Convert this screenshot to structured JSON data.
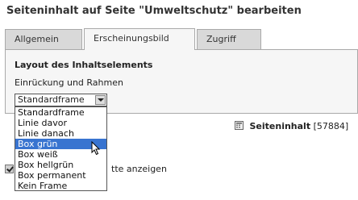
{
  "page": {
    "title": "Seiteninhalt auf Seite \"Umweltschutz\" bearbeiten"
  },
  "tabs": [
    {
      "label": "Allgemein"
    },
    {
      "label": "Erscheinungsbild",
      "active": true
    },
    {
      "label": "Zugriff"
    }
  ],
  "panel": {
    "section_heading": "Layout des Inhaltselements",
    "field_label": "Einrückung und Rahmen",
    "select_value": "Standardframe",
    "options": [
      "Standardframe",
      "Linie davor",
      "Linie danach",
      "Box grün",
      "Box weiß",
      "Box hellgrün",
      "Box permanent",
      "Kein Frame"
    ],
    "highlighted_option": "Box grün"
  },
  "reference": {
    "icon": "content-element-icon",
    "text": "Seiteninhalt",
    "id": "[57884]"
  },
  "checkbox": {
    "label_visible": "tte anzeigen",
    "checked": true
  },
  "colors": {
    "highlight": "#3874d0",
    "tab_bg": "#d9d9d9",
    "panel_bg": "#f6f6f6"
  }
}
